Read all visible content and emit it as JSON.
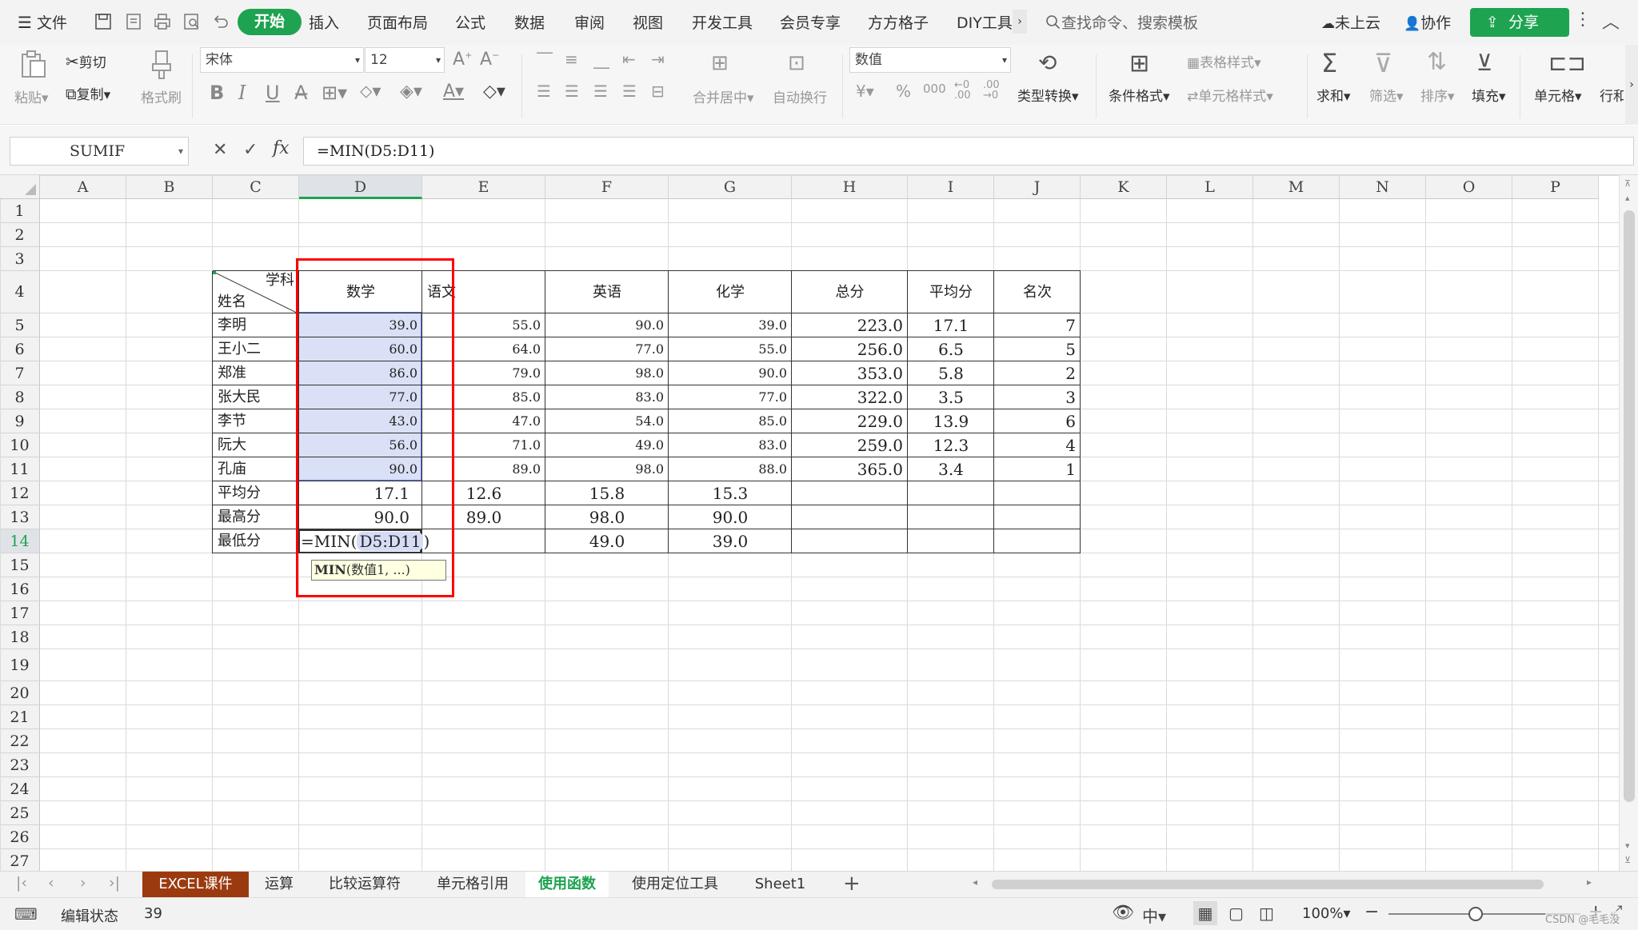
{
  "menu": {
    "file": "文件",
    "tabs": [
      "开始",
      "插入",
      "页面布局",
      "公式",
      "数据",
      "审阅",
      "视图",
      "开发工具",
      "会员专享",
      "方方格子",
      "DIY工具"
    ],
    "search": "查找命令、搜索模板",
    "cloud": "未上云",
    "collab": "协作",
    "share": "分享"
  },
  "ribbon": {
    "paste": "粘贴",
    "cut": "剪切",
    "copy": "复制",
    "format_painter": "格式刷",
    "font_name": "宋体",
    "font_size": "12",
    "merge": "合并居中",
    "wrap": "自动换行",
    "number_format": "数值",
    "convert": "类型转换",
    "cond_format": "条件格式",
    "table_style": "表格样式",
    "cell_style": "单元格样式",
    "sum": "求和",
    "filter": "筛选",
    "sort": "排序",
    "fill": "填充",
    "cell": "单元格",
    "row_col": "行和"
  },
  "formula_bar": {
    "name_box": "SUMIF",
    "fx": "fx",
    "formula": "=MIN(D5:D11)"
  },
  "columns": [
    "A",
    "B",
    "C",
    "D",
    "E",
    "F",
    "G",
    "H",
    "I",
    "J",
    "K",
    "L",
    "M",
    "N",
    "O",
    "P"
  ],
  "rows": [
    "1",
    "2",
    "3",
    "4",
    "5",
    "6",
    "7",
    "8",
    "9",
    "10",
    "11",
    "12",
    "13",
    "14",
    "15",
    "16",
    "17",
    "18",
    "19",
    "20",
    "21",
    "22",
    "23",
    "24",
    "25",
    "26",
    "27"
  ],
  "table": {
    "corner_top": "学科",
    "corner_bottom": "姓名",
    "headers": [
      "数学",
      "语文",
      "英语",
      "化学",
      "总分",
      "平均分",
      "名次"
    ],
    "rows": [
      {
        "name": "李明",
        "math": "39.0",
        "chinese": "55.0",
        "english": "90.0",
        "chem": "39.0",
        "total": "223.0",
        "avg": "17.1",
        "rank": "7"
      },
      {
        "name": "王小二",
        "math": "60.0",
        "chinese": "64.0",
        "english": "77.0",
        "chem": "55.0",
        "total": "256.0",
        "avg": "6.5",
        "rank": "5"
      },
      {
        "name": "郑准",
        "math": "86.0",
        "chinese": "79.0",
        "english": "98.0",
        "chem": "90.0",
        "total": "353.0",
        "avg": "5.8",
        "rank": "2"
      },
      {
        "name": "张大民",
        "math": "77.0",
        "chinese": "85.0",
        "english": "83.0",
        "chem": "77.0",
        "total": "322.0",
        "avg": "3.5",
        "rank": "3"
      },
      {
        "name": "李节",
        "math": "43.0",
        "chinese": "47.0",
        "english": "54.0",
        "chem": "85.0",
        "total": "229.0",
        "avg": "13.9",
        "rank": "6"
      },
      {
        "name": "阮大",
        "math": "56.0",
        "chinese": "71.0",
        "english": "49.0",
        "chem": "83.0",
        "total": "259.0",
        "avg": "12.3",
        "rank": "4"
      },
      {
        "name": "孔庙",
        "math": "90.0",
        "chinese": "89.0",
        "english": "98.0",
        "chem": "88.0",
        "total": "365.0",
        "avg": "3.4",
        "rank": "1"
      }
    ],
    "avg_row": {
      "label": "平均分",
      "math": "17.1",
      "chinese": "12.6",
      "english": "15.8",
      "chem": "15.3"
    },
    "max_row": {
      "label": "最高分",
      "math": "90.0",
      "chinese": "89.0",
      "english": "98.0",
      "chem": "90.0"
    },
    "min_row": {
      "label": "最低分",
      "formula_prefix": "=MIN(",
      "formula_ref": "D5:D11",
      "formula_suffix": ")",
      "english": "49.0",
      "chem": "39.0"
    },
    "tooltip_fn": "MIN",
    "tooltip_args": "(数值1, ...)"
  },
  "sheet_tabs": [
    "EXCEL课件",
    "运算",
    "比较运算符",
    "单元格引用",
    "使用函数",
    "使用定位工具",
    "Sheet1"
  ],
  "active_sheet": "使用函数",
  "status": {
    "mode": "编辑状态",
    "value": "39",
    "zoom": "100%",
    "watermark": "CSDN @毛毛没"
  },
  "colors": {
    "accent": "#1ea350",
    "selection": "#dae0f5",
    "highlight_box": "#ff0000",
    "first_tab": "#9b3a0f"
  }
}
